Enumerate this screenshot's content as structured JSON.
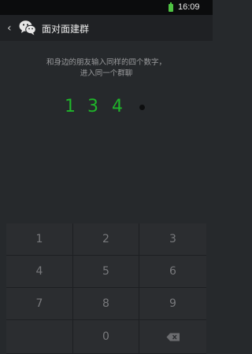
{
  "status_bar": {
    "time": "16:09",
    "battery_color": "#4fc343"
  },
  "header": {
    "title": "面对面建群",
    "back_icon": "chevron-left-icon",
    "logo_icon": "wechat-logo-icon"
  },
  "instruction": {
    "line1": "和身边的朋友输入同样的四个数字，",
    "line2": "进入同一个群聊"
  },
  "entered_digits": [
    "1",
    "3",
    "4"
  ],
  "accent_color": "#1fb52a",
  "keypad": {
    "k1": "1",
    "k2": "2",
    "k3": "3",
    "k4": "4",
    "k5": "5",
    "k6": "6",
    "k7": "7",
    "k8": "8",
    "k9": "9",
    "k0": "0",
    "delete_icon": "backspace-icon"
  }
}
